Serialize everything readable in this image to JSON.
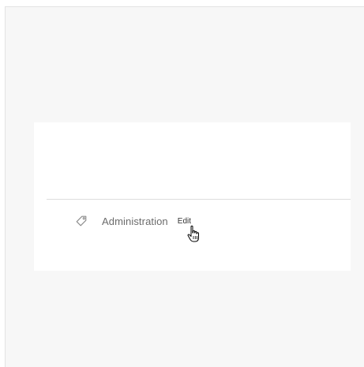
{
  "tag": {
    "icon": "tag-icon",
    "label": "Administration",
    "edit_label": "Edit"
  },
  "cursor": {
    "icon": "hand-pointer-cursor-icon"
  }
}
